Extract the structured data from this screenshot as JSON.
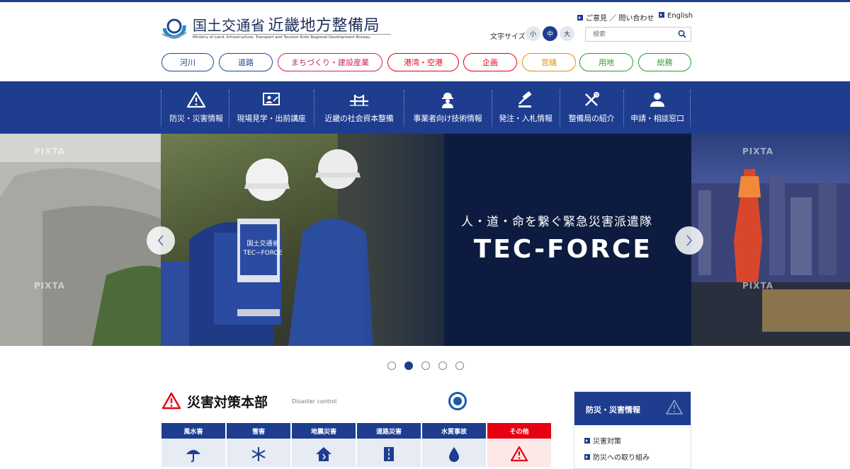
{
  "header": {
    "logo_ministry": "国土交通省",
    "logo_bureau": "近畿地方整備局",
    "logo_en": "Ministry of Land, Infrastructure, Transport and Tourism Kinki Regional Development Bureau",
    "contact_link": "ご意見 ／ 問い合わせ",
    "english_link": "English",
    "font_size_label": "文字サイズ",
    "font_sizes": [
      "小",
      "中",
      "大"
    ],
    "font_size_selected": "中",
    "search_placeholder": "検索"
  },
  "categories": [
    "河川",
    "道路",
    "まちづくり・建設産業",
    "港湾・空港",
    "企画",
    "営繕",
    "用地",
    "総務"
  ],
  "category_colors": [
    "#1e4596",
    "#1e4596",
    "#c8265d",
    "#e60012",
    "#e60012",
    "#e39300",
    "#2c9a2f",
    "#2c9a2f"
  ],
  "main_nav": [
    {
      "label": "防災・災害情報",
      "icon": "warning-icon"
    },
    {
      "label": "現場見学・出前講座",
      "icon": "presentation-icon"
    },
    {
      "label": "近畿の社会資本整備",
      "icon": "bridge-icon"
    },
    {
      "label": "事業者向け技術情報",
      "icon": "worker-icon"
    },
    {
      "label": "発注・入札情報",
      "icon": "gavel-icon"
    },
    {
      "label": "整備局の紹介",
      "icon": "tools-icon"
    },
    {
      "label": "申請・相談窓口",
      "icon": "person-icon"
    }
  ],
  "hero": {
    "subtitle": "人・道・命を繋ぐ緊急災害派遣隊",
    "title": "TEC-FORCE",
    "vest_line1": "国土交通省",
    "vest_line2": "TEC−FORCE",
    "watermark": "PIXTA",
    "total_slides": 5,
    "active_slide": 2
  },
  "disaster": {
    "heading": "災害対策本部",
    "heading_en": "Disaster control",
    "tabs": [
      {
        "label": "風水害",
        "icon": "umbrella-icon"
      },
      {
        "label": "雪害",
        "icon": "snowflake-icon"
      },
      {
        "label": "地震災害",
        "icon": "house-quake-icon"
      },
      {
        "label": "道路災害",
        "icon": "road-icon"
      },
      {
        "label": "水質事故",
        "icon": "water-drop-icon"
      },
      {
        "label": "その他",
        "icon": "warning-icon"
      }
    ]
  },
  "sidebar": {
    "title": "防災・災害情報",
    "links": [
      "災害対策",
      "防災への取り組み"
    ]
  },
  "colors": {
    "primary": "#1e3d8f",
    "alert": "#e60012",
    "status": "#1e5aa8"
  }
}
